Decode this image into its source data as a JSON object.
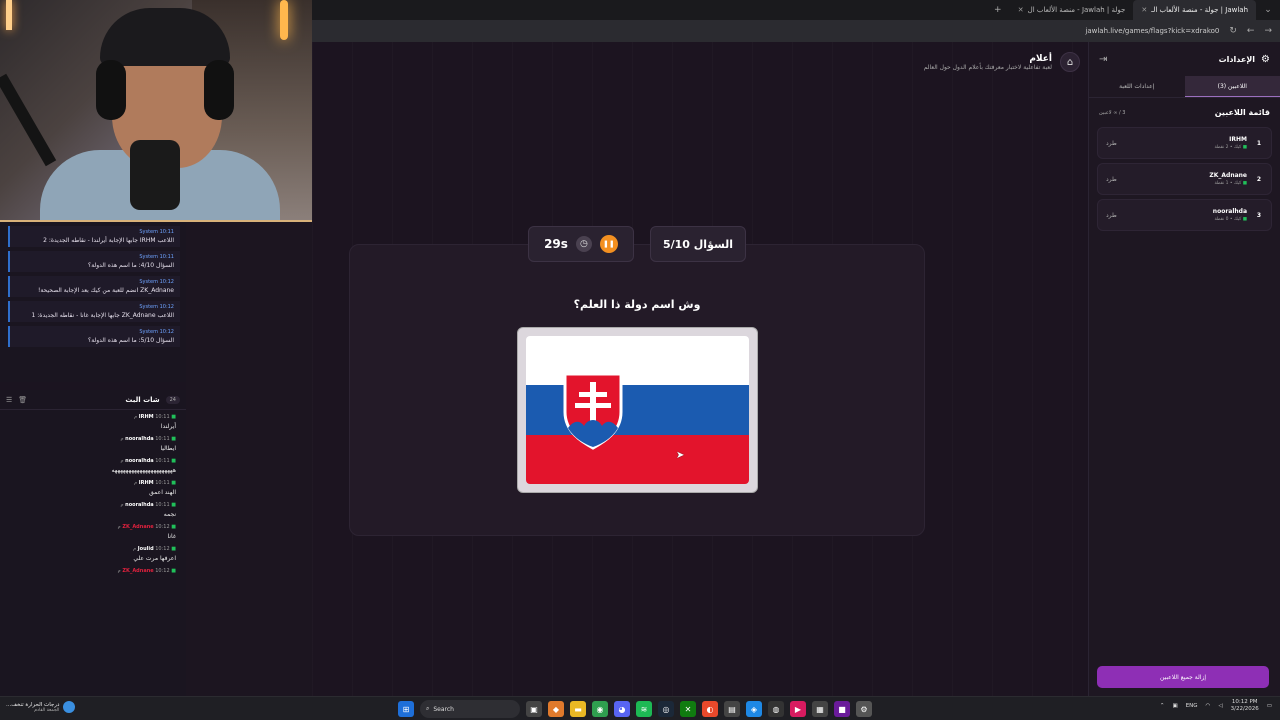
{
  "browser": {
    "tabs": [
      {
        "label": "جولة | Jawlah - منصة الألعاب ال",
        "active": false
      },
      {
        "label": "Jawlah | جولة - منصة الألعاب الـ",
        "active": true
      }
    ],
    "url": "jawlah.live/games/flags?kick=xdrako0"
  },
  "system_log": [
    {
      "meta": "System 10:11",
      "text": "اللاعب IRHM جابها الإجابة أيرلندا - نقاطه الجديدة: 2"
    },
    {
      "meta": "System 10:11",
      "text": "السؤال 4/10: ما اسم هذه الدولة؟"
    },
    {
      "meta": "System 10:12",
      "text": "ZK_Adnane انضم للعبة من كيك بعد الإجابة الصحيحة!"
    },
    {
      "meta": "System 10:12",
      "text": "اللاعب ZK_Adnane جابها الإجابة غانا - نقاطه الجديدة: 1"
    },
    {
      "meta": "System 10:12",
      "text": "السؤال 5/10: ما اسم هذه الدولة؟"
    }
  ],
  "chat": {
    "title": "شات البث",
    "count": "24",
    "messages": [
      {
        "user": "IRHM",
        "time": "10:11 م",
        "text": "أيرلندا",
        "color": "#ffffff"
      },
      {
        "user": "nooralhda",
        "time": "10:11 م",
        "text": "ايطاليا",
        "color": "#ffffff"
      },
      {
        "user": "nooralhda",
        "time": "10:11 م",
        "text": "ههههههههههههههههههههههه",
        "color": "#ffffff"
      },
      {
        "user": "IRHM",
        "time": "10:11 م",
        "text": "الهند اعمق",
        "color": "#ffffff"
      },
      {
        "user": "nooralhda",
        "time": "10:11 م",
        "text": "نجمه",
        "color": "#ffffff"
      },
      {
        "user": "ZK_Adnane",
        "time": "10:12 م",
        "text": "غانا",
        "color": "#e0213d"
      },
      {
        "user": "Joulid",
        "time": "10:12 م",
        "text": "اعرفها مرت علي",
        "color": "#ffffff"
      },
      {
        "user": "ZK_Adnane",
        "time": "10:12 م",
        "text": "",
        "color": "#e0213d"
      }
    ]
  },
  "page": {
    "title": "أعلام",
    "subtitle": "لعبة تفاعلية لاختبار معرفتك بأعلام الدول حول العالم"
  },
  "game": {
    "timer": "29s",
    "question_number": "السؤال 5/10",
    "question": "وش اسم دولة ذا العلم؟",
    "flag_colors": [
      "#ffffff",
      "#1b5bb0",
      "#e3142c"
    ]
  },
  "sidebar": {
    "title": "الإعدادات",
    "tabs": [
      {
        "label": "اللاعبين (3)",
        "active": true
      },
      {
        "label": "إعدادات اللعبة",
        "active": false
      }
    ],
    "list_title": "قائمة اللاعبين",
    "list_count": "3 / ∞ لاعبين",
    "players": [
      {
        "rank": "1",
        "name": "IRHM",
        "meta": "كيك • 2 نقطة",
        "kick": "طرد"
      },
      {
        "rank": "2",
        "name": "ZK_Adnane",
        "meta": "كيك • 1 نقطة",
        "kick": "طرد"
      },
      {
        "rank": "3",
        "name": "nooralhda",
        "meta": "كيك • 0 نقطة",
        "kick": "طرد"
      }
    ],
    "remove_all": "إزالة جميع اللاعبين"
  },
  "taskbar": {
    "weather_title": "درجات الحرارة تنخف...",
    "weather_sub": "الجمعة القادم",
    "search_label": "Search",
    "lang": "ENG",
    "time": "10:12 PM",
    "date": "3/22/2026"
  },
  "colors": {
    "accent": "#8e2fb5",
    "pause": "#f39021",
    "kick_green": "#20c05a",
    "system_blue": "#2f6fcc"
  }
}
